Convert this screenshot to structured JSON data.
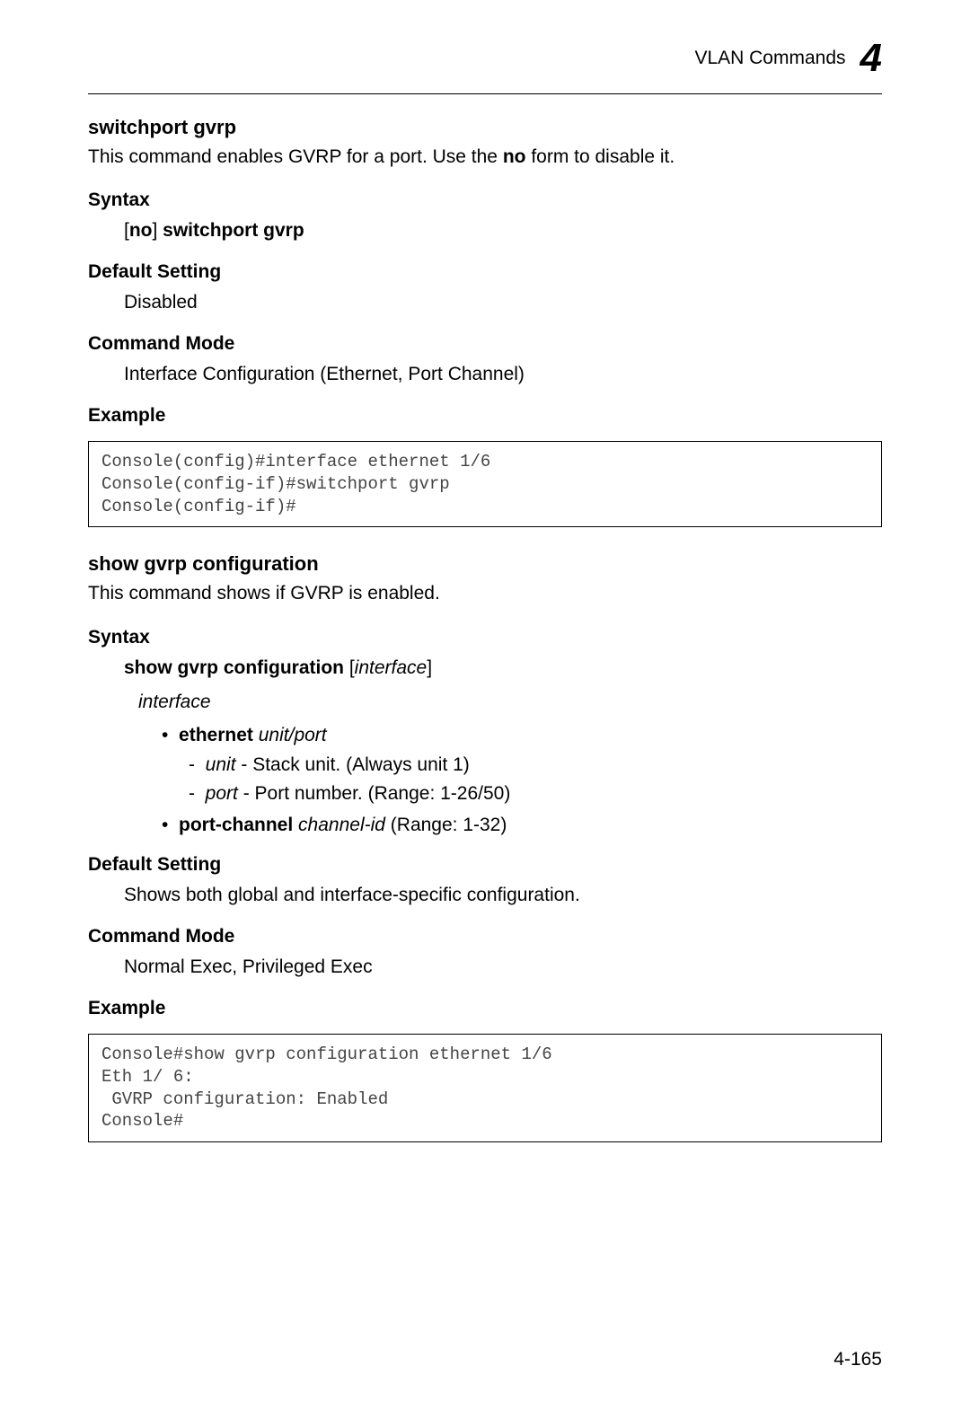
{
  "header": {
    "category": "VLAN Commands",
    "chapter": "4"
  },
  "cmd1": {
    "title": "switchport gvrp",
    "desc_pre": "This command enables GVRP for a port. Use the ",
    "desc_bold": "no",
    "desc_post": " form to disable it.",
    "syntax_label": "Syntax",
    "syntax_pre": "[",
    "syntax_bold1": "no",
    "syntax_mid": "] ",
    "syntax_bold2": "switchport gvrp",
    "default_label": "Default Setting",
    "default_value": "Disabled",
    "mode_label": "Command Mode",
    "mode_value": "Interface Configuration (Ethernet, Port Channel)",
    "example_label": "Example",
    "example_code": "Console(config)#interface ethernet 1/6\nConsole(config-if)#switchport gvrp\nConsole(config-if)#"
  },
  "cmd2": {
    "title": "show gvrp configuration",
    "desc": "This command shows if GVRP is enabled.",
    "syntax_label": "Syntax",
    "syntax_bold": "show gvrp configuration",
    "syntax_mid": " [",
    "syntax_ital": "interface",
    "syntax_post": "]",
    "interface_label": "interface",
    "bullet1_bold": "ethernet",
    "bullet1_ital": "unit",
    "bullet1_sep": "/",
    "bullet1_ital2": "port",
    "dash1_ital": "unit",
    "dash1_text": " - Stack unit. (Always unit 1)",
    "dash2_ital": "port",
    "dash2_text": " - Port number. (Range: 1-26/50)",
    "bullet2_bold": "port-channel",
    "bullet2_ital": "channel-id",
    "bullet2_text": " (Range: 1-32)",
    "default_label": "Default Setting",
    "default_value": "Shows both global and interface-specific configuration.",
    "mode_label": "Command Mode",
    "mode_value": "Normal Exec, Privileged Exec",
    "example_label": "Example",
    "example_code": "Console#show gvrp configuration ethernet 1/6\nEth 1/ 6:\n GVRP configuration: Enabled\nConsole#"
  },
  "page_number": "4-165",
  "glyphs": {
    "bullet": "•",
    "dash": "-"
  }
}
